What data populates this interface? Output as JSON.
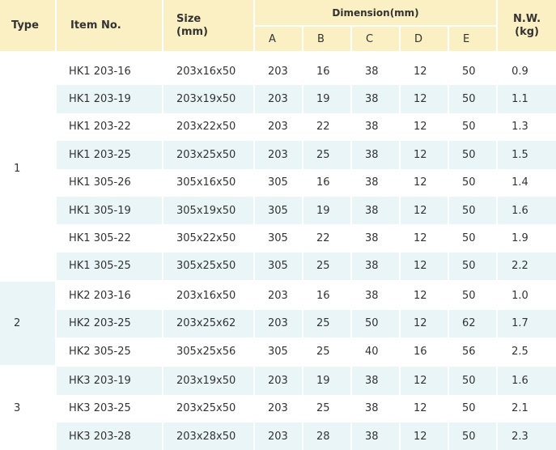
{
  "headers": {
    "type": "Type",
    "item": "Item No.",
    "size_line1": "Size",
    "size_line2": "(mm)",
    "dimension": "Dimension(mm)",
    "dims": [
      "A",
      "B",
      "C",
      "D",
      "E"
    ],
    "nw_line1": "N.W.",
    "nw_line2": "(kg)"
  },
  "groups": [
    {
      "type": "1",
      "rows": [
        {
          "item": "HK1 203-16",
          "size": "203x16x50",
          "a": "203",
          "b": "16",
          "c": "38",
          "d": "12",
          "e": "50",
          "nw": "0.9"
        },
        {
          "item": "HK1 203-19",
          "size": "203x19x50",
          "a": "203",
          "b": "19",
          "c": "38",
          "d": "12",
          "e": "50",
          "nw": "1.1"
        },
        {
          "item": "HK1 203-22",
          "size": "203x22x50",
          "a": "203",
          "b": "22",
          "c": "38",
          "d": "12",
          "e": "50",
          "nw": "1.3"
        },
        {
          "item": "HK1 203-25",
          "size": "203x25x50",
          "a": "203",
          "b": "25",
          "c": "38",
          "d": "12",
          "e": "50",
          "nw": "1.5"
        },
        {
          "item": "HK1 305-26",
          "size": "305x16x50",
          "a": "305",
          "b": "16",
          "c": "38",
          "d": "12",
          "e": "50",
          "nw": "1.4"
        },
        {
          "item": "HK1 305-19",
          "size": "305x19x50",
          "a": "305",
          "b": "19",
          "c": "38",
          "d": "12",
          "e": "50",
          "nw": "1.6"
        },
        {
          "item": "HK1 305-22",
          "size": "305x22x50",
          "a": "305",
          "b": "22",
          "c": "38",
          "d": "12",
          "e": "50",
          "nw": "1.9"
        },
        {
          "item": "HK1 305-25",
          "size": "305x25x50",
          "a": "305",
          "b": "25",
          "c": "38",
          "d": "12",
          "e": "50",
          "nw": "2.2"
        }
      ]
    },
    {
      "type": "2",
      "rows": [
        {
          "item": "HK2 203-16",
          "size": "203x16x50",
          "a": "203",
          "b": "16",
          "c": "38",
          "d": "12",
          "e": "50",
          "nw": "1.0"
        },
        {
          "item": "HK2 203-25",
          "size": "203x25x62",
          "a": "203",
          "b": "25",
          "c": "50",
          "d": "12",
          "e": "62",
          "nw": "1.7"
        },
        {
          "item": "HK2 305-25",
          "size": "305x25x56",
          "a": "305",
          "b": "25",
          "c": "40",
          "d": "16",
          "e": "56",
          "nw": "2.5"
        }
      ]
    },
    {
      "type": "3",
      "rows": [
        {
          "item": "HK3 203-19",
          "size": "203x19x50",
          "a": "203",
          "b": "19",
          "c": "38",
          "d": "12",
          "e": "50",
          "nw": "1.6"
        },
        {
          "item": "HK3 203-25",
          "size": "203x25x50",
          "a": "203",
          "b": "25",
          "c": "38",
          "d": "12",
          "e": "50",
          "nw": "2.1"
        },
        {
          "item": "HK3 203-28",
          "size": "203x28x50",
          "a": "203",
          "b": "28",
          "c": "38",
          "d": "12",
          "e": "50",
          "nw": "2.3"
        }
      ]
    }
  ],
  "colors": {
    "header_bg": "#fbefc4",
    "band_bg": "#eaf5f8",
    "text": "#333333"
  }
}
